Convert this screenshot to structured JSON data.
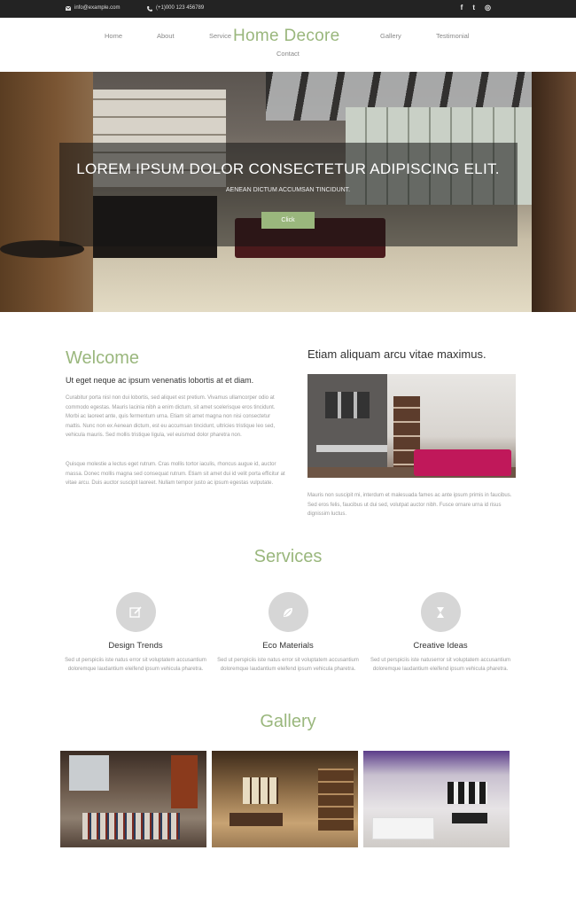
{
  "topbar": {
    "email": "info@example.com",
    "phone": "(+1)000 123 456789",
    "socials": [
      {
        "icon": "facebook-icon",
        "glyph": "f"
      },
      {
        "icon": "twitter-icon",
        "glyph": "t"
      },
      {
        "icon": "dribbble-icon",
        "glyph": "◎"
      }
    ]
  },
  "nav": {
    "brand": "Home Decore",
    "items": [
      "Home",
      "About",
      "Service",
      "Gallery",
      "Testimonial",
      "Contact"
    ]
  },
  "hero": {
    "title": "LOREM IPSUM DOLOR CONSECTETUR ADIPISCING ELIT.",
    "subtitle": "AENEAN DICTUM ACCUMSAN TINCIDUNT.",
    "button": "Click"
  },
  "welcome": {
    "title": "Welcome",
    "subtitle": "Ut eget neque ac ipsum venenatis lobortis at et diam.",
    "para1": "Curabitur porta nisl non dui lobortis, sed aliquet est pretium. Vivamus ullamcorper odio at commodo egestas. Mauris lacinia nibh a enim dictum, sit amet scelerisque eros tincidunt. Morbi ac laoreet ante, quis fermentum urna. Etiam sit amet magna non nisi consectetur mattis. Nunc non ex Aenean dictum, est eu accumsan tincidunt, ultricies tristique leo sed, vehicula mauris. Sed mollis tristique ligula, vel euismod dolor pharetra non.",
    "para2": "Quisque molestie a lectus eget rutrum. Cras mollis tortor iaculis, rhoncus augue id, auctor massa. Donec mollis magna sed consequat rutrum. Etiam sit amet dui id velit porta efficitur at vitae arcu. Duis auctor suscipit laoreet. Nullam tempor justo ac ipsum egestas vulputate."
  },
  "feature": {
    "title": "Etiam aliquam arcu vitae maximus.",
    "para": "Mauris non suscipit mi, interdum et malesuada fames ac ante ipsum primis in faucibus. Sed eros felis, faucibus ut dui sed, volutpat auctor nibh. Fusce ornare urna id risus dignissim luctus."
  },
  "services": {
    "title": "Services",
    "items": [
      {
        "icon": "edit-icon",
        "name": "Design Trends",
        "desc": "Sed ut perspiciis iste natus error sit voluptatem accusantium doloremque laudantium eleifend ipsum vehicula pharetra."
      },
      {
        "icon": "leaf-icon",
        "name": "Eco Materials",
        "desc": "Sed ut perspiciis iste natus error sit voluptatem accusantium doloremque laudantium eleifend ipsum vehicula pharetra."
      },
      {
        "icon": "hourglass-icon",
        "name": "Creative Ideas",
        "desc": "Sed ut perspiciis iste natuserror sit voluptatem accusantium doloremque laudantium eleifend ipsum vehicula pharetra."
      }
    ]
  },
  "gallery": {
    "title": "Gallery"
  },
  "colors": {
    "accent": "#9ab77d",
    "topbar": "#232323"
  }
}
